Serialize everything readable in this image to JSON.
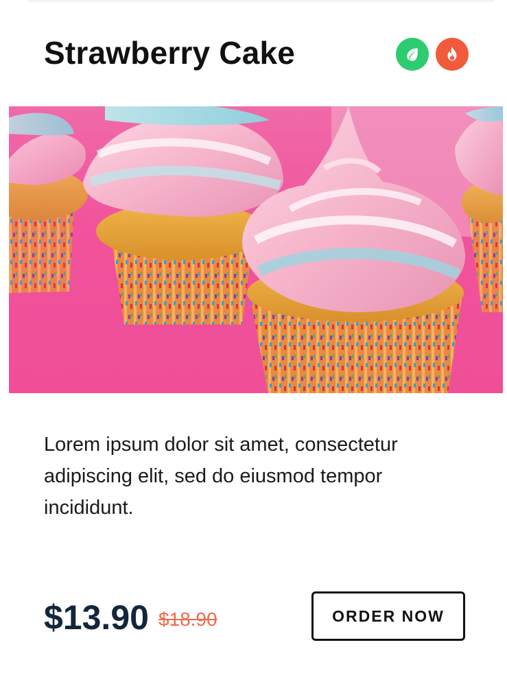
{
  "product": {
    "title": "Strawberry Cake",
    "description": "Lorem ipsum dolor sit amet, consectetur adipiscing elit, sed do eiusmod tempor incididunt.",
    "price": "$13.90",
    "old_price": "$18.90",
    "order_label": "ORDER NOW"
  },
  "badges": [
    {
      "icon": "leaf-icon",
      "color": "#2ecc71"
    },
    {
      "icon": "flame-icon",
      "color": "#f15a3a"
    }
  ],
  "image": {
    "subject": "cupcakes-photo"
  },
  "colors": {
    "price": "#13263c",
    "old_price": "#f06a4a",
    "background_pink": "#f2529a"
  }
}
